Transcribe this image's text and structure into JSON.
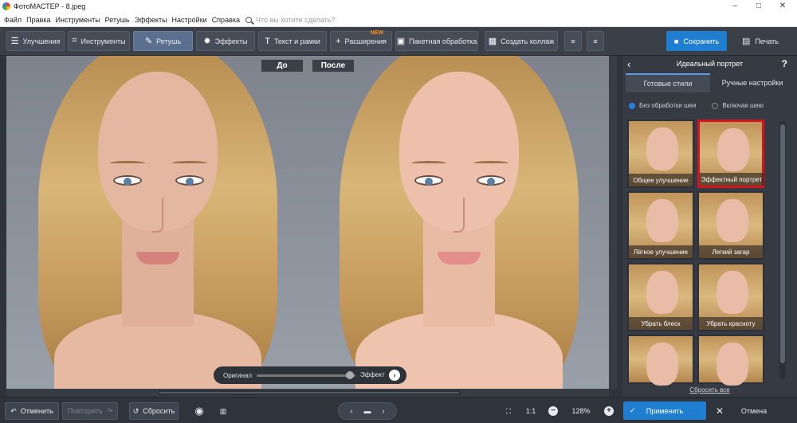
{
  "window": {
    "title": "ФотоМАСТЕР - 8.jpeg",
    "minimize": "–",
    "maximize": "□",
    "close": "✕"
  },
  "menu": {
    "items": [
      "Файл",
      "Правка",
      "Инструменты",
      "Ретушь",
      "Эффекты",
      "Настройки",
      "Справка"
    ],
    "search_placeholder": "Что вы хотите сделать?"
  },
  "toolbar": {
    "tabs": [
      {
        "label": "Улучшения",
        "icon": "sliders-icon"
      },
      {
        "label": "Инструменты",
        "icon": "crop-icon"
      },
      {
        "label": "Ретушь",
        "icon": "brush-icon",
        "active": true
      },
      {
        "label": "Эффекты",
        "icon": "sparkle-icon"
      },
      {
        "label": "Текст и рамки",
        "icon": "text-icon"
      },
      {
        "label": "Расширения",
        "icon": "plus-icon",
        "badge": "NEW"
      },
      {
        "label": "Пакетная обработка",
        "icon": "images-icon"
      },
      {
        "label": "Создать коллаж",
        "icon": "collage-icon"
      }
    ],
    "save_label": "Сохранить",
    "print_label": "Печать"
  },
  "canvas": {
    "before_label": "До",
    "after_label": "После",
    "slider_left": "Оригинал",
    "slider_right": "Эффект"
  },
  "panel": {
    "title": "Идеальный портрет",
    "help": "?",
    "tabs": [
      "Готовые стили",
      "Ручные настройки"
    ],
    "radio_options": [
      {
        "label": "Без обработки шеи",
        "selected": true
      },
      {
        "label": "Включая шею",
        "selected": false
      }
    ],
    "presets": [
      "Общее улучшение",
      "Эффектный портрет",
      "Лёгкое улучшение",
      "Легкий загар",
      "Убрать блеск",
      "Убрать красноту",
      "",
      ""
    ],
    "selected_preset": "Эффектный портрет",
    "reset_all": "Сбросить все"
  },
  "bottom": {
    "undo": "Отменить",
    "redo": "Повторить",
    "reset": "Сбросить",
    "ratio": "1:1",
    "zoom": "128%",
    "apply": "Применить",
    "cancel": "Отмена"
  },
  "colors": {
    "accent": "#1f7ed0",
    "active_tab": "#5b6f8e",
    "selection": "#d2141e",
    "badge": "#ff8a1f"
  }
}
